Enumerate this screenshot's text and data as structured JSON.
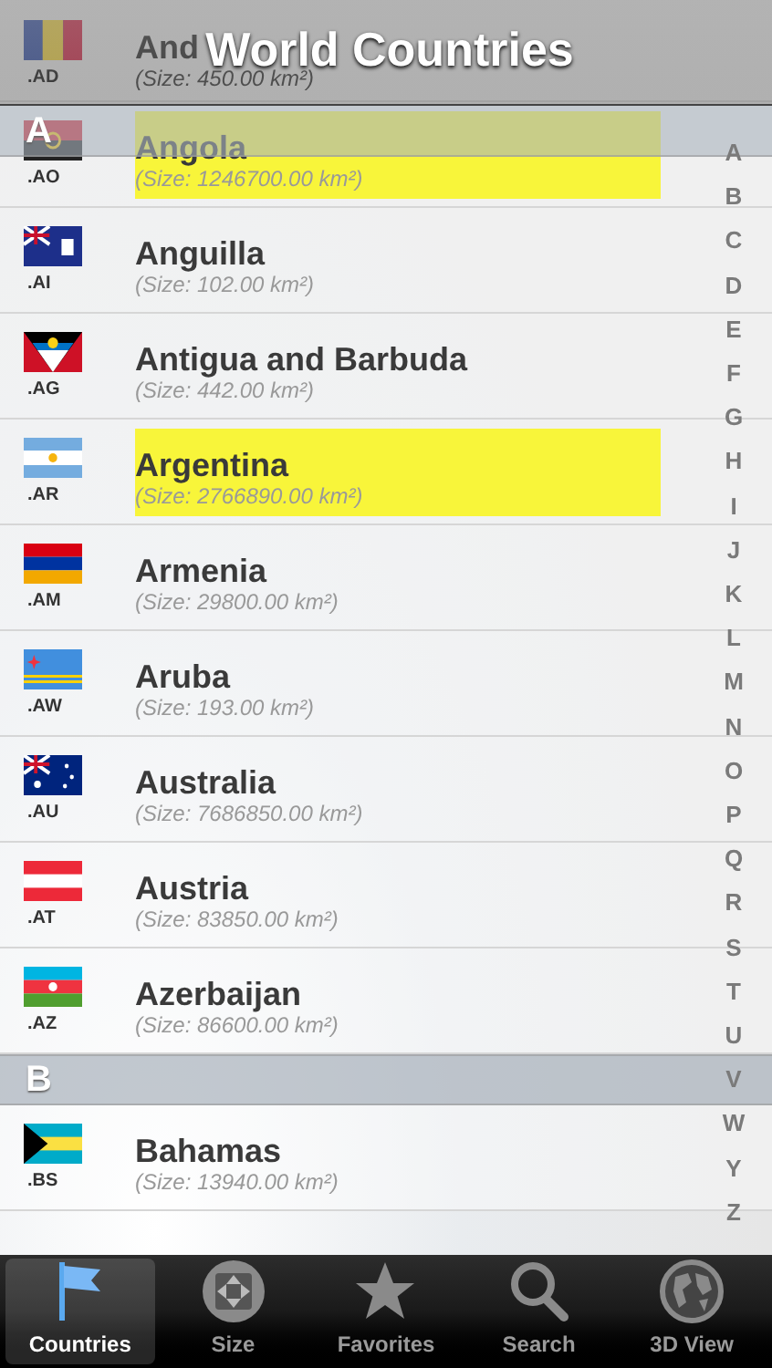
{
  "title": "World Countries",
  "countries": [
    {
      "domain": ".AD",
      "name": "And",
      "size": "(Size: 450.00 km²)",
      "highlighted": false
    },
    {
      "domain": ".AO",
      "name": "Angola",
      "size": "(Size: 1246700.00 km²)",
      "highlighted": true
    },
    {
      "domain": ".AI",
      "name": "Anguilla",
      "size": "(Size: 102.00 km²)",
      "highlighted": false
    },
    {
      "domain": ".AG",
      "name": "Antigua and Barbuda",
      "size": "(Size: 442.00 km²)",
      "highlighted": false
    },
    {
      "domain": ".AR",
      "name": "Argentina",
      "size": "(Size: 2766890.00 km²)",
      "highlighted": true
    },
    {
      "domain": ".AM",
      "name": "Armenia",
      "size": "(Size: 29800.00 km²)",
      "highlighted": false
    },
    {
      "domain": ".AW",
      "name": "Aruba",
      "size": "(Size: 193.00 km²)",
      "highlighted": false
    },
    {
      "domain": ".AU",
      "name": "Australia",
      "size": "(Size: 7686850.00 km²)",
      "highlighted": false
    },
    {
      "domain": ".AT",
      "name": "Austria",
      "size": "(Size: 83850.00 km²)",
      "highlighted": false
    },
    {
      "domain": ".AZ",
      "name": "Azerbaijan",
      "size": "(Size: 86600.00 km²)",
      "highlighted": false
    },
    {
      "domain": ".BS",
      "name": "Bahamas",
      "size": "(Size: 13940.00 km²)",
      "highlighted": false,
      "section": "B"
    }
  ],
  "sticky_section": "A",
  "index": [
    "A",
    "B",
    "C",
    "D",
    "E",
    "F",
    "G",
    "H",
    "I",
    "J",
    "K",
    "L",
    "M",
    "N",
    "O",
    "P",
    "Q",
    "R",
    "S",
    "T",
    "U",
    "V",
    "W",
    "Y",
    "Z"
  ],
  "tabs": [
    {
      "label": "Countries",
      "selected": true
    },
    {
      "label": "Size",
      "selected": false
    },
    {
      "label": "Favorites",
      "selected": false
    },
    {
      "label": "Search",
      "selected": false
    },
    {
      "label": "3D View",
      "selected": false
    }
  ]
}
